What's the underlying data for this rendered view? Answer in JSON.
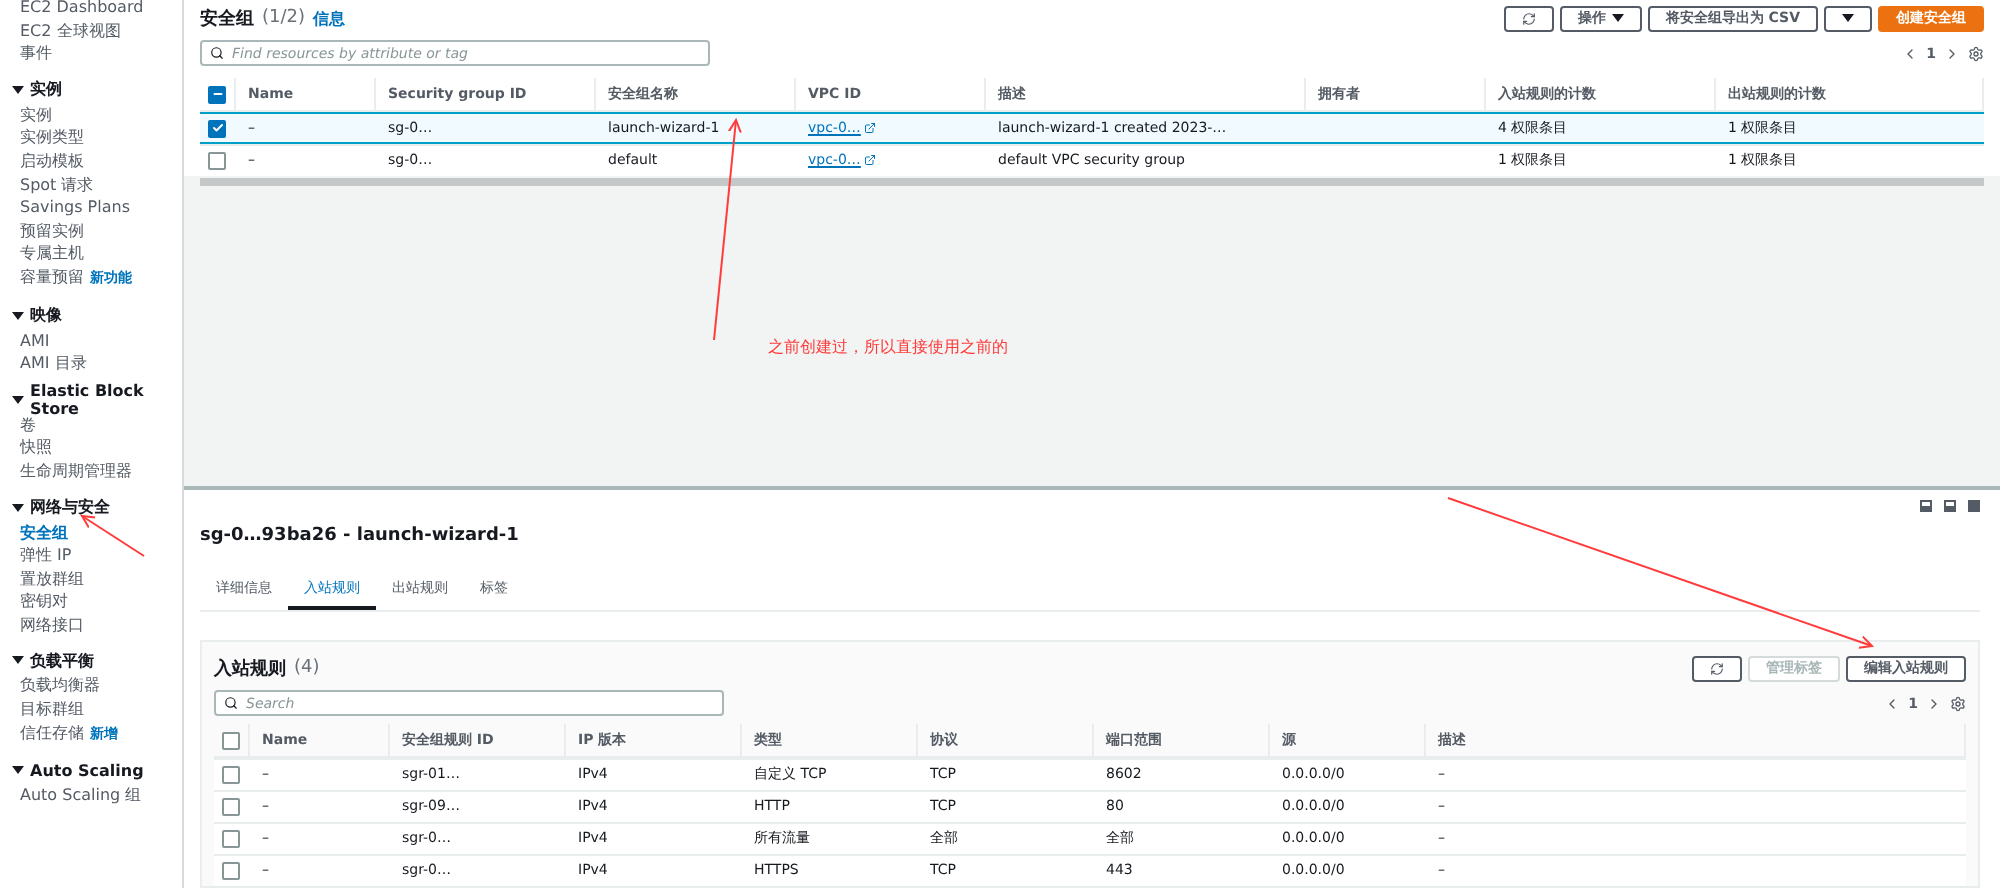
{
  "sidebar": {
    "sections": [
      {
        "items": [
          {
            "label": "EC2 Dashboard",
            "selected": false
          },
          {
            "label": "EC2 全球视图",
            "selected": false
          },
          {
            "label": "事件",
            "selected": false
          }
        ]
      },
      {
        "title": "实例",
        "expanded": true,
        "items": [
          {
            "label": "实例",
            "selected": false
          },
          {
            "label": "实例类型",
            "selected": false
          },
          {
            "label": "启动模板",
            "selected": false
          },
          {
            "label": "Spot 请求",
            "selected": false
          },
          {
            "label": "Savings Plans",
            "selected": false
          },
          {
            "label": "预留实例",
            "selected": false
          },
          {
            "label": "专属主机",
            "selected": false
          },
          {
            "label": "容量预留",
            "selected": false,
            "badge": "新功能"
          }
        ]
      },
      {
        "title": "映像",
        "expanded": true,
        "items": [
          {
            "label": "AMI",
            "selected": false
          },
          {
            "label": "AMI 目录",
            "selected": false
          }
        ]
      },
      {
        "title": "Elastic Block Store",
        "expanded": true,
        "items": [
          {
            "label": "卷",
            "selected": false
          },
          {
            "label": "快照",
            "selected": false
          },
          {
            "label": "生命周期管理器",
            "selected": false
          }
        ]
      },
      {
        "title": "网络与安全",
        "expanded": true,
        "items": [
          {
            "label": "安全组",
            "selected": true
          },
          {
            "label": "弹性 IP",
            "selected": false
          },
          {
            "label": "置放群组",
            "selected": false
          },
          {
            "label": "密钥对",
            "selected": false
          },
          {
            "label": "网络接口",
            "selected": false
          }
        ]
      },
      {
        "title": "负载平衡",
        "expanded": true,
        "items": [
          {
            "label": "负载均衡器",
            "selected": false
          },
          {
            "label": "目标群组",
            "selected": false
          },
          {
            "label": "信任存储",
            "selected": false,
            "badge": "新增"
          }
        ]
      },
      {
        "title": "Auto Scaling",
        "expanded": true,
        "items": [
          {
            "label": "Auto Scaling 组",
            "selected": false
          }
        ]
      }
    ]
  },
  "top": {
    "title": "安全组",
    "count": "(1/2)",
    "info": "信息",
    "buttons": [
      {
        "kind": "icon"
      },
      {
        "kind": "menu",
        "label": "操作"
      },
      {
        "kind": "normal",
        "label": "将安全组导出为 CSV"
      },
      {
        "kind": "icon-menu"
      },
      {
        "kind": "primary",
        "label": "创建安全组"
      }
    ],
    "search": {
      "placeholder": "Find resources by attribute or tag"
    },
    "page": "1",
    "header_checkbox": {
      "checked": true,
      "partial": true
    },
    "columns": [
      "Name",
      "Security group ID",
      "安全组名称",
      "VPC ID",
      "描述",
      "拥有者",
      "入站规则的计数",
      "出站规则的计数"
    ],
    "rows": [
      {
        "selected": true,
        "cells": [
          "–",
          "sg-0…",
          "launch-wizard-1",
          "vpc-0…",
          "launch-wizard-1 created 2023-…",
          "",
          "4 权限条目",
          "1 权限条目"
        ]
      },
      {
        "selected": false,
        "cells": [
          "–",
          "sg-0…",
          "default",
          "vpc-0…",
          "default VPC security group",
          "",
          "1 权限条目",
          "1 权限条目"
        ]
      }
    ]
  },
  "annotation": "之前创建过，所以直接使用之前的",
  "detail": {
    "title": "sg-0…93ba26 - launch-wizard-1",
    "tabs": [
      {
        "label": "详细信息",
        "selected": false
      },
      {
        "label": "入站规则",
        "selected": true
      },
      {
        "label": "出站规则",
        "selected": false
      },
      {
        "label": "标签",
        "selected": false
      }
    ],
    "card": {
      "title": "入站规则",
      "count": "(4)",
      "buttons": [
        {
          "kind": "icon",
          "disabled": false
        },
        {
          "kind": "normal",
          "label": "管理标签",
          "disabled": true
        },
        {
          "kind": "normal",
          "label": "编辑入站规则",
          "disabled": false
        }
      ],
      "search": {
        "placeholder": "Search"
      },
      "page": "1",
      "header_checkbox": {
        "checked": false
      },
      "columns": [
        "Name",
        "安全组规则 ID",
        "IP 版本",
        "类型",
        "协议",
        "端口范围",
        "源",
        "描述"
      ],
      "rows": [
        {
          "selected": false,
          "cells": [
            "–",
            "sgr-01…",
            "IPv4",
            "自定义 TCP",
            "TCP",
            "8602",
            "0.0.0.0/0",
            "–"
          ]
        },
        {
          "selected": false,
          "cells": [
            "–",
            "sgr-09…",
            "IPv4",
            "HTTP",
            "TCP",
            "80",
            "0.0.0.0/0",
            "–"
          ]
        },
        {
          "selected": false,
          "cells": [
            "–",
            "sgr-0…",
            "IPv4",
            "所有流量",
            "全部",
            "全部",
            "0.0.0.0/0",
            "–"
          ]
        },
        {
          "selected": false,
          "cells": [
            "–",
            "sgr-0…",
            "IPv4",
            "HTTPS",
            "TCP",
            "443",
            "0.0.0.0/0",
            "–"
          ]
        }
      ]
    }
  }
}
